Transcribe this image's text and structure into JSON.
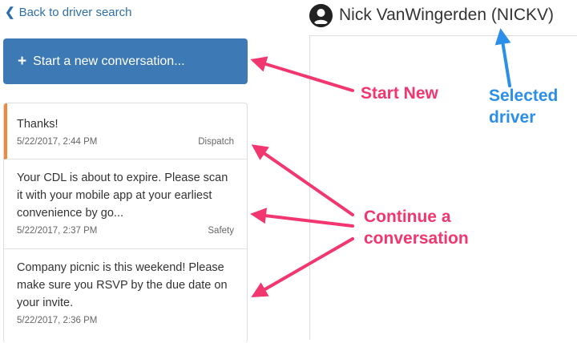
{
  "nav": {
    "back_label": "Back to driver search"
  },
  "driver": {
    "name": "Nick VanWingerden (NICKV)",
    "icon": "user-circle-icon"
  },
  "actions": {
    "new_conversation_label": "Start a new conversation..."
  },
  "conversations": [
    {
      "message": "Thanks!",
      "timestamp": "5/22/2017, 2:44 PM",
      "category": "Dispatch",
      "active": true
    },
    {
      "message": "Your CDL is about to expire. Please scan it with your mobile app at your earliest convenience by go...",
      "timestamp": "5/22/2017, 2:37 PM",
      "category": "Safety",
      "active": false
    },
    {
      "message": "Company picnic is this weekend! Please make sure you RSVP by the due date on your invite.",
      "timestamp": "5/22/2017, 2:36 PM",
      "category": "",
      "active": false
    }
  ],
  "annotations": {
    "start_new": "Start New",
    "selected_driver": "Selected driver",
    "continue": "Continue a conversation",
    "colors": {
      "pink": "#f2366f",
      "blue": "#2b8fe9",
      "accent": "#f0883e",
      "button": "#3d7ab5"
    }
  }
}
